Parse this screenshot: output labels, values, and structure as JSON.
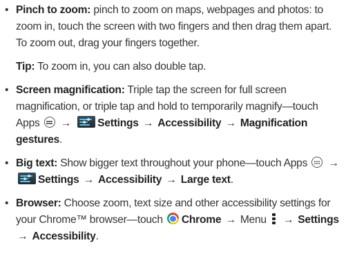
{
  "bullet": "•",
  "arrow": "→",
  "pinch": {
    "title": "Pinch to zoom:",
    "body": " pinch to zoom on maps, webpages and photos: to zoom in, touch the screen with two fingers and then drag them apart. To zoom out, drag your fingers together."
  },
  "tip": {
    "title": "Tip:",
    "body": " To zoom in, you can also double tap."
  },
  "magnification": {
    "title": "Screen magnification:",
    "body": " Triple tap the screen for full screen magnification, or triple tap and hold to temporarily magnify—touch Apps",
    "settings": "Settings",
    "accessibility": "Accessibility",
    "gestures": "Magnification gestures",
    "end": "."
  },
  "bigtext": {
    "title": "Big text:",
    "body": " Show bigger text throughout your phone—touch Apps",
    "settings": "Settings",
    "accessibility": "Accessibility",
    "large": "Large text",
    "end": "."
  },
  "browser": {
    "title": "Browser:",
    "body": " Choose zoom, text size and other accessibility settings for your Chrome™ browser—touch",
    "chrome": "Chrome",
    "menu": "Menu",
    "settings": "Settings",
    "accessibility": "Accessibility",
    "end": "."
  },
  "icons": {
    "apps": "apps-icon",
    "settings": "settings-icon",
    "chrome": "chrome-icon",
    "menu": "menu-icon"
  },
  "colors": {
    "text": "#333333",
    "bold": "#222222",
    "chrome_blue": "#4285f4",
    "settings_accent": "#5ec3e6"
  }
}
